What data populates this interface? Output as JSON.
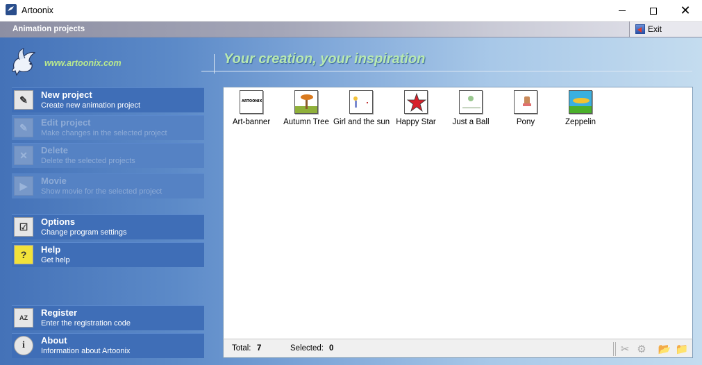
{
  "window": {
    "title": "Artoonix",
    "minimize_glyph": "",
    "maximize_glyph": "",
    "close_glyph": "✕"
  },
  "header": {
    "title": "Animation projects",
    "exit_label": "Exit"
  },
  "brand": {
    "url": "www.artoonix.com",
    "slogan": "Your creation, your inspiration"
  },
  "menu": [
    {
      "title": "New project",
      "desc": "Create new animation project",
      "icon": "new-project-icon",
      "enabled": true
    },
    {
      "title": "Edit project",
      "desc": "Make changes in the selected project",
      "icon": "edit-project-icon",
      "enabled": false
    },
    {
      "title": "Delete",
      "desc": "Delete the selected projects",
      "icon": "delete-icon",
      "enabled": false
    },
    {
      "title": "Movie",
      "desc": "Show movie for the selected project",
      "icon": "movie-icon",
      "enabled": false
    },
    {
      "title": "Options",
      "desc": "Change program settings",
      "icon": "options-icon",
      "enabled": true
    },
    {
      "title": "Help",
      "desc": "Get help",
      "icon": "help-icon",
      "enabled": true
    },
    {
      "title": "Register",
      "desc": "Enter the registration code",
      "icon": "register-icon",
      "enabled": true
    },
    {
      "title": "About",
      "desc": "Information about Artoonix",
      "icon": "about-icon",
      "enabled": true
    }
  ],
  "projects": [
    {
      "name": "Art-banner",
      "thumb_text": "ARTOONIX"
    },
    {
      "name": "Autumn Tree"
    },
    {
      "name": "Girl and the sun"
    },
    {
      "name": "Happy Star"
    },
    {
      "name": "Just a Ball"
    },
    {
      "name": "Pony"
    },
    {
      "name": "Zeppelin"
    }
  ],
  "status": {
    "total_label": "Total:",
    "total_value": "7",
    "selected_label": "Selected:",
    "selected_value": "0"
  },
  "colors": {
    "accent_green": "#b8e8b0",
    "menu_blue": "#3f6eb7"
  }
}
